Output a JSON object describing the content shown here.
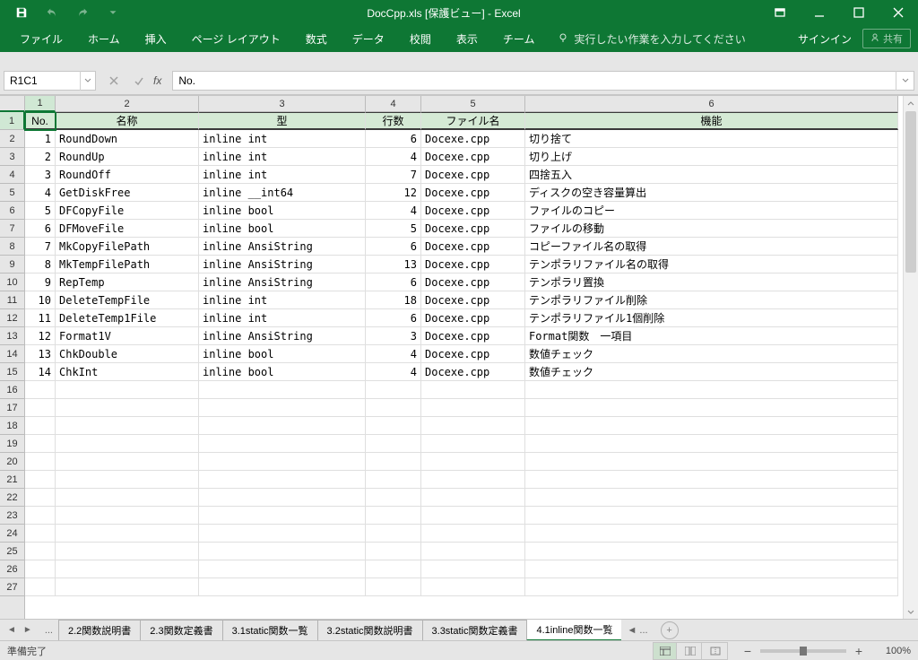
{
  "titlebar": {
    "title": "DocCpp.xls  [保護ビュー] - Excel"
  },
  "ribbon": {
    "tabs": [
      "ファイル",
      "ホーム",
      "挿入",
      "ページ レイアウト",
      "数式",
      "データ",
      "校閲",
      "表示",
      "チーム"
    ],
    "tellme": "実行したい作業を入力してください",
    "signin": "サインイン",
    "share": "共有"
  },
  "fx": {
    "namebox": "R1C1",
    "formula": "No."
  },
  "grid": {
    "colLabels": [
      "1",
      "2",
      "3",
      "4",
      "5",
      "6"
    ],
    "rowLabels": [
      "1",
      "2",
      "3",
      "4",
      "5",
      "6",
      "7",
      "8",
      "9",
      "10",
      "11",
      "12",
      "13",
      "14",
      "15",
      "16",
      "17",
      "18",
      "19",
      "20",
      "21",
      "22",
      "23",
      "24",
      "25",
      "26",
      "27"
    ],
    "headers": [
      "No.",
      "名称",
      "型",
      "行数",
      "ファイル名",
      "機能"
    ],
    "rows": [
      {
        "no": "1",
        "name": "RoundDown",
        "type": "inline int",
        "lines": "6",
        "file": "Docexe.cpp",
        "func": "切り捨て"
      },
      {
        "no": "2",
        "name": "RoundUp",
        "type": "inline int",
        "lines": "4",
        "file": "Docexe.cpp",
        "func": "切り上げ"
      },
      {
        "no": "3",
        "name": "RoundOff",
        "type": "inline int",
        "lines": "7",
        "file": "Docexe.cpp",
        "func": "四捨五入"
      },
      {
        "no": "4",
        "name": "GetDiskFree",
        "type": "inline __int64",
        "lines": "12",
        "file": "Docexe.cpp",
        "func": "ディスクの空き容量算出"
      },
      {
        "no": "5",
        "name": "DFCopyFile",
        "type": "inline bool",
        "lines": "4",
        "file": "Docexe.cpp",
        "func": "ファイルのコピー"
      },
      {
        "no": "6",
        "name": "DFMoveFile",
        "type": "inline bool",
        "lines": "5",
        "file": "Docexe.cpp",
        "func": "ファイルの移動"
      },
      {
        "no": "7",
        "name": "MkCopyFilePath",
        "type": "inline AnsiString",
        "lines": "6",
        "file": "Docexe.cpp",
        "func": "コピーファイル名の取得"
      },
      {
        "no": "8",
        "name": "MkTempFilePath",
        "type": "inline AnsiString",
        "lines": "13",
        "file": "Docexe.cpp",
        "func": "テンポラリファイル名の取得"
      },
      {
        "no": "9",
        "name": "RepTemp",
        "type": "inline AnsiString",
        "lines": "6",
        "file": "Docexe.cpp",
        "func": "テンポラリ置換"
      },
      {
        "no": "10",
        "name": "DeleteTempFile",
        "type": "inline int",
        "lines": "18",
        "file": "Docexe.cpp",
        "func": "テンポラリファイル削除"
      },
      {
        "no": "11",
        "name": "DeleteTemp1File",
        "type": "inline int",
        "lines": "6",
        "file": "Docexe.cpp",
        "func": "テンポラリファイル1個削除"
      },
      {
        "no": "12",
        "name": "Format1V",
        "type": "inline AnsiString",
        "lines": "3",
        "file": "Docexe.cpp",
        "func": "Format関数　一項目"
      },
      {
        "no": "13",
        "name": "ChkDouble",
        "type": "inline bool",
        "lines": "4",
        "file": "Docexe.cpp",
        "func": "数値チェック"
      },
      {
        "no": "14",
        "name": "ChkInt",
        "type": "inline bool",
        "lines": "4",
        "file": "Docexe.cpp",
        "func": "数値チェック"
      }
    ]
  },
  "sheetbar": {
    "ellipsis": "...",
    "more": "...",
    "tabs": [
      {
        "label": "2.2関数説明書",
        "active": false
      },
      {
        "label": "2.3関数定義書",
        "active": false
      },
      {
        "label": "3.1static関数一覧",
        "active": false
      },
      {
        "label": "3.2static関数説明書",
        "active": false
      },
      {
        "label": "3.3static関数定義書",
        "active": false
      },
      {
        "label": "4.1inline関数一覧",
        "active": true
      }
    ]
  },
  "statusbar": {
    "ready": "準備完了",
    "zoom": "100%"
  }
}
